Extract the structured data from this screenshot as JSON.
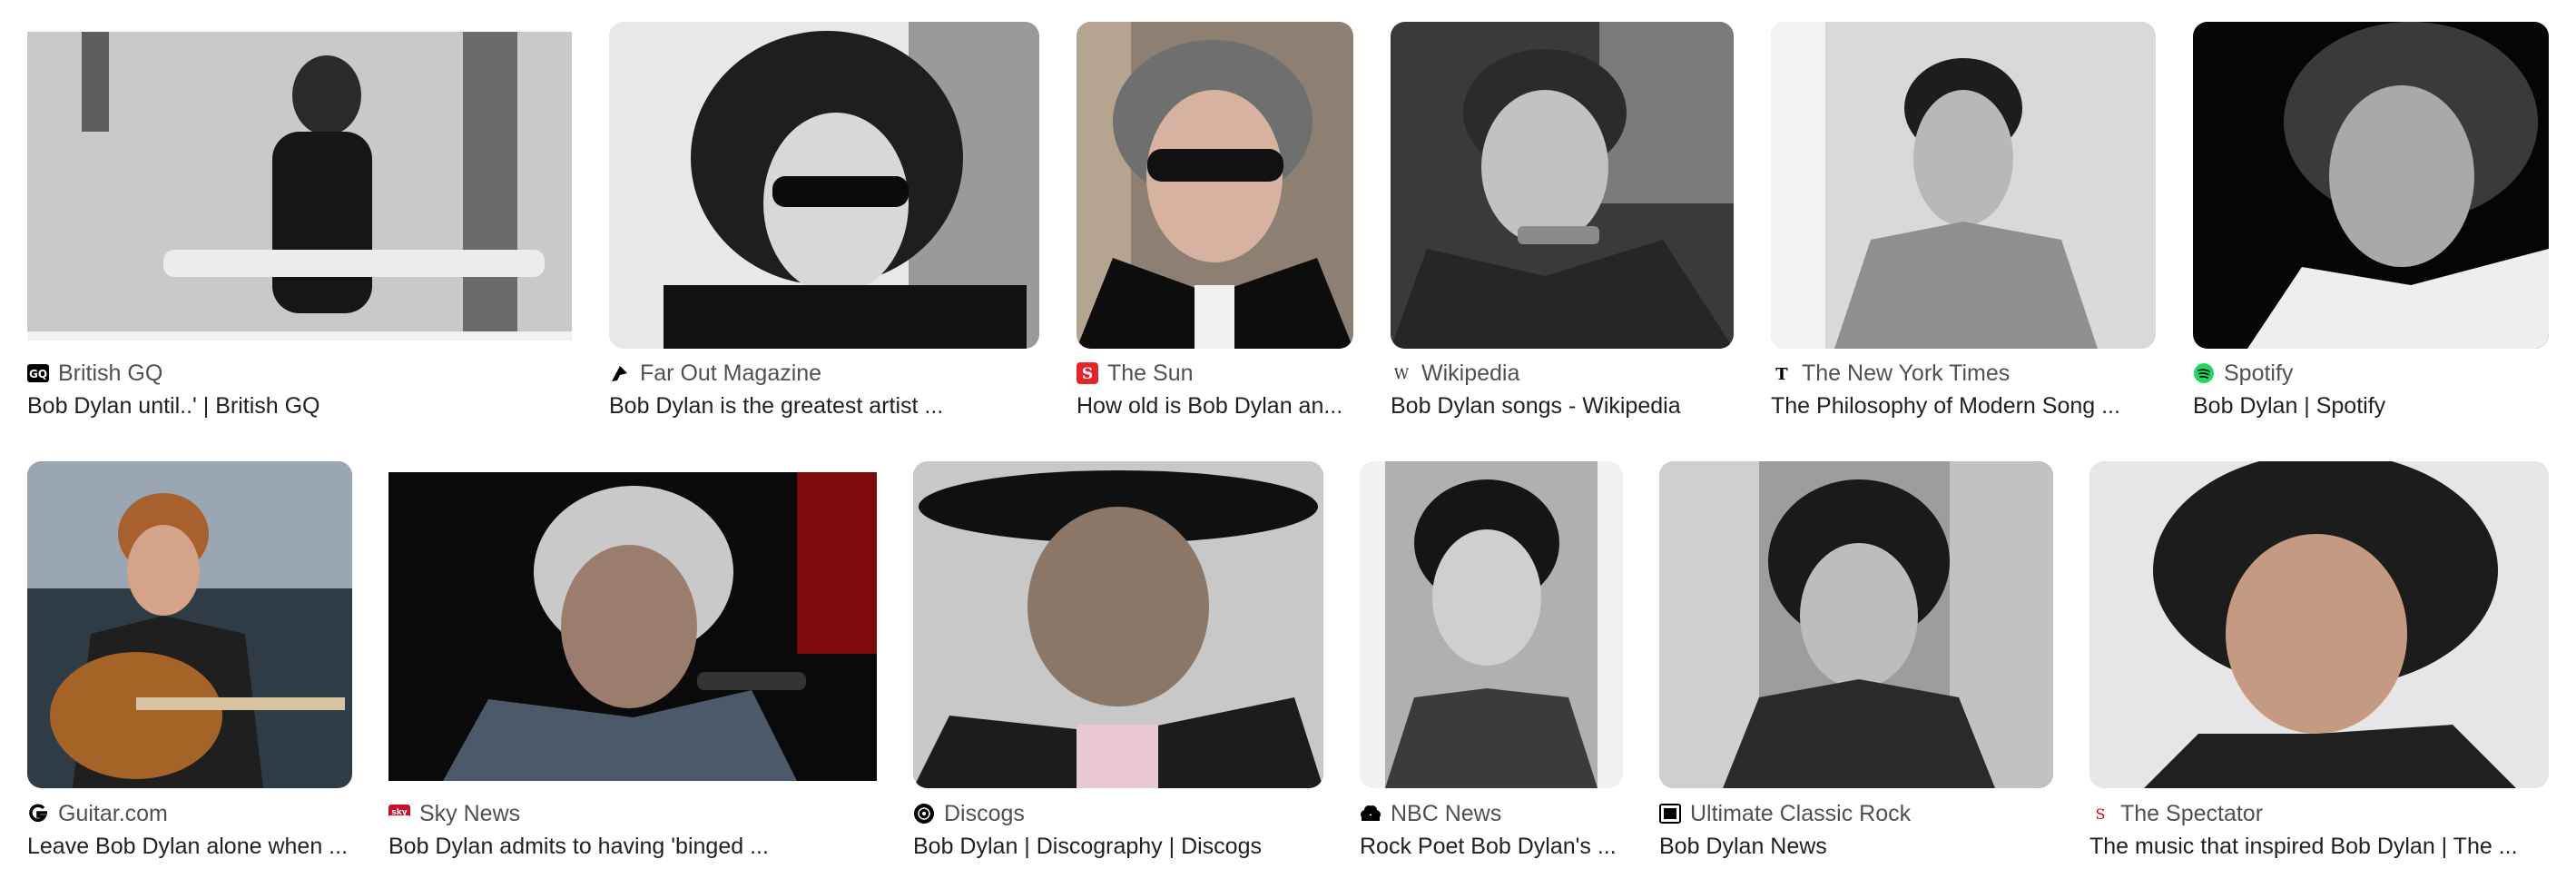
{
  "results": [
    {
      "source": "British GQ",
      "title": "Bob Dylan until..' | British GQ",
      "favicon": "gq-icon",
      "accent": "#000000"
    },
    {
      "source": "Far Out Magazine",
      "title": "Bob Dylan is the greatest artist ...",
      "favicon": "far-out-icon",
      "accent": "#000000"
    },
    {
      "source": "The Sun",
      "title": "How old is Bob Dylan an...",
      "favicon": "the-sun-icon",
      "accent": "#e4252b"
    },
    {
      "source": "Wikipedia",
      "title": "Bob Dylan songs - Wikipedia",
      "favicon": "wikipedia-icon",
      "accent": "#333333"
    },
    {
      "source": "The New York Times",
      "title": "The Philosophy of Modern Song ...",
      "favicon": "nyt-icon",
      "accent": "#000000"
    },
    {
      "source": "Spotify",
      "title": "Bob Dylan | Spotify",
      "favicon": "spotify-icon",
      "accent": "#1ed760"
    },
    {
      "source": "Guitar.com",
      "title": "Leave Bob Dylan alone when ...",
      "favicon": "guitar-com-icon",
      "accent": "#000000"
    },
    {
      "source": "Sky News",
      "title": "Bob Dylan admits to having 'binged ...",
      "favicon": "sky-news-icon",
      "accent": "#c8102e"
    },
    {
      "source": "Discogs",
      "title": "Bob Dylan | Discography | Discogs",
      "favicon": "discogs-icon",
      "accent": "#000000"
    },
    {
      "source": "NBC News",
      "title": "Rock Poet Bob Dylan's ...",
      "favicon": "nbc-news-icon",
      "accent": "#000000"
    },
    {
      "source": "Ultimate Classic Rock",
      "title": "Bob Dylan News",
      "favicon": "ucr-icon",
      "accent": "#000000"
    },
    {
      "source": "The Spectator",
      "title": "The music that inspired Bob Dylan | The ...",
      "favicon": "spectator-icon",
      "accent": "#d6001c"
    }
  ]
}
